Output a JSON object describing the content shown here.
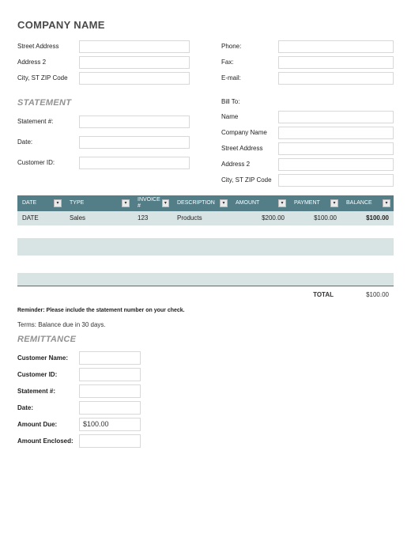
{
  "company_name": "COMPANY NAME",
  "company_fields": {
    "street": "Street Address",
    "addr2": "Address 2",
    "cityzip": "City, ST  ZIP Code"
  },
  "contact_fields": {
    "phone": "Phone:",
    "fax": "Fax:",
    "email": "E-mail:"
  },
  "statement_title": "STATEMENT",
  "statement_fields": {
    "num": "Statement #:",
    "date": "Date:",
    "cust": "Customer ID:"
  },
  "billto_label": "Bill To:",
  "billto_fields": {
    "name": "Name",
    "company": "Company Name",
    "street": "Street Address",
    "addr2": "Address 2",
    "cityzip": "City, ST  ZIP Code"
  },
  "columns": {
    "date": "DATE",
    "type": "TYPE",
    "invoice": "INVOICE #",
    "desc": "DESCRIPTION",
    "amount": "AMOUNT",
    "payment": "PAYMENT",
    "balance": "BALANCE"
  },
  "row": {
    "date": "DATE",
    "type": "Sales",
    "invoice": "123",
    "desc": "Products",
    "amount": "$200.00",
    "payment": "$100.00",
    "balance": "$100.00"
  },
  "total_label": "TOTAL",
  "total_value": "$100.00",
  "reminder": "Reminder: Please include the statement number on your check.",
  "terms": "Terms: Balance due in 30 days.",
  "remittance_title": "REMITTANCE",
  "remittance_fields": {
    "custname": "Customer Name:",
    "custid": "Customer ID:",
    "stmt": "Statement #:",
    "date": "Date:",
    "due": "Amount Due:",
    "enclosed": "Amount Enclosed:"
  },
  "amount_due_value": "$100.00",
  "chart_data": {
    "type": "table",
    "title": "Billing Statement",
    "columns": [
      "DATE",
      "TYPE",
      "INVOICE #",
      "DESCRIPTION",
      "AMOUNT",
      "PAYMENT",
      "BALANCE"
    ],
    "rows": [
      {
        "DATE": "DATE",
        "TYPE": "Sales",
        "INVOICE #": 123,
        "DESCRIPTION": "Products",
        "AMOUNT": 200.0,
        "PAYMENT": 100.0,
        "BALANCE": 100.0
      }
    ],
    "total": 100.0
  }
}
